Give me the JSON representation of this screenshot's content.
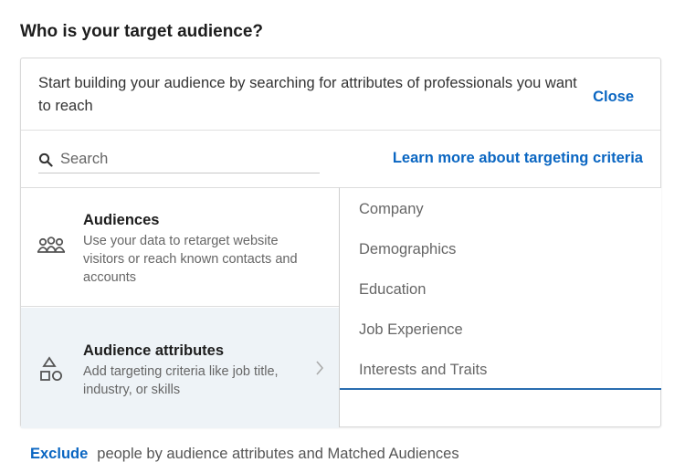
{
  "heading": "Who is your target audience?",
  "intro": {
    "text": "Start building your audience by searching for attributes of professionals you want to reach",
    "close_label": "Close"
  },
  "search": {
    "placeholder": "Search",
    "learn_more_label": "Learn more about targeting criteria"
  },
  "categories": [
    {
      "title": "Audiences",
      "description": "Use your data to retarget website visitors or reach known contacts and accounts",
      "icon": "people-group-icon"
    },
    {
      "title": "Audience attributes",
      "description": "Add targeting criteria like job title, industry, or skills",
      "icon": "shapes-icon"
    }
  ],
  "attribute_options": [
    "Company",
    "Demographics",
    "Education",
    "Job Experience",
    "Interests and Traits"
  ],
  "footer": {
    "exclude_label": "Exclude",
    "text": "people by audience attributes and Matched Audiences"
  },
  "colors": {
    "link": "#0a66c2",
    "selected_bg": "#eef3f7",
    "active_border": "#2a6db0"
  }
}
